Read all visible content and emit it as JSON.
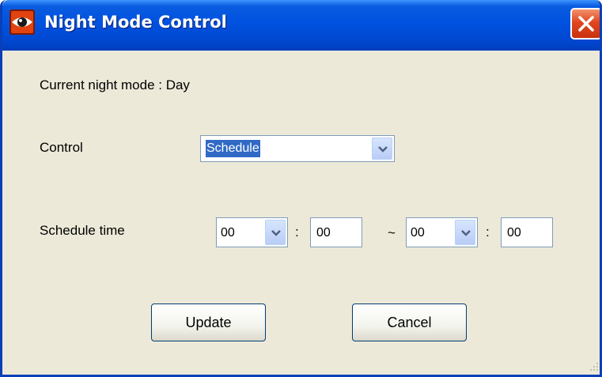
{
  "window": {
    "title": "Night Mode Control",
    "icon": "eye-icon",
    "close_icon": "close-icon"
  },
  "status": {
    "text": "Current night mode : Day"
  },
  "control": {
    "label": "Control",
    "selected": "Schedule"
  },
  "schedule": {
    "label": "Schedule time",
    "start_hour": "00",
    "start_minute": "00",
    "end_hour": "00",
    "end_minute": "00",
    "colon": ":",
    "tilde": "~"
  },
  "buttons": {
    "update": "Update",
    "cancel": "Cancel"
  },
  "colors": {
    "title_bar": "#0052e0",
    "dialog_bg": "#ece9d8",
    "close_button": "#e0461e",
    "selection": "#316ac5"
  }
}
